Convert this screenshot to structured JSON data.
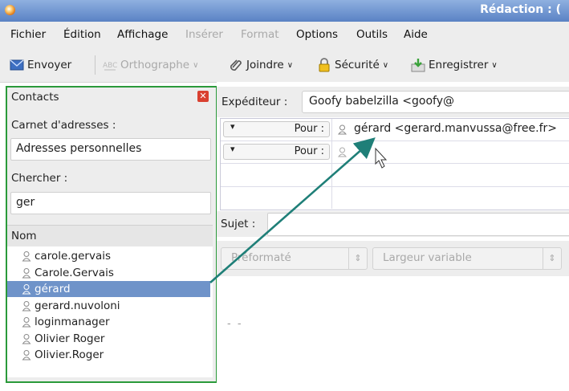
{
  "window": {
    "title": "Rédaction : ("
  },
  "menubar": {
    "items": [
      {
        "label": "Fichier",
        "u": "F"
      },
      {
        "label": "Édition"
      },
      {
        "label": "Affichage"
      },
      {
        "label": "Insérer"
      },
      {
        "label": "Format"
      },
      {
        "label": "Options"
      },
      {
        "label": "Outils"
      },
      {
        "label": "Aide"
      }
    ]
  },
  "toolbar": {
    "send": "Envoyer",
    "spell": "Orthographe",
    "attach": "Joindre",
    "security": "Sécurité",
    "save": "Enregistrer"
  },
  "sidebar": {
    "title": "Contacts",
    "addressbook_label": "Carnet d'adresses :",
    "addressbook_value": "Adresses personnelles",
    "search_label": "Chercher :",
    "search_value": "ger",
    "column_header": "Nom",
    "contacts": [
      "carole.gervais",
      "Carole.Gervais",
      "gérard",
      "gerard.nuvoloni",
      "loginmanager",
      "Olivier Roger",
      "Olivier.Roger"
    ],
    "selected_index": 2
  },
  "compose": {
    "from_label": "Expéditeur :",
    "from_value": "Goofy babelzilla <goofy@",
    "recipients": [
      {
        "type": "Pour :",
        "address": "gérard <gerard.manvussa@free.fr>"
      },
      {
        "type": "Pour :",
        "address": ""
      }
    ],
    "subject_label": "Sujet :",
    "subject_value": "",
    "format_style": "Préformaté",
    "font_width": "Largeur variable",
    "body_text": "- -"
  },
  "colors": {
    "sidebar_border": "#2a9a3a",
    "selection": "#6f93c9",
    "arrow": "#1f7f78"
  }
}
